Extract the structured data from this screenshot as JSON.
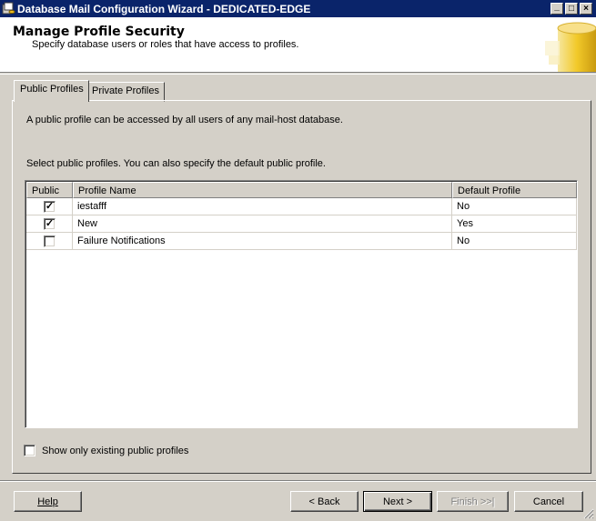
{
  "window": {
    "title": "Database Mail Configuration Wizard - DEDICATED-EDGE",
    "controls": {
      "minimize": "_",
      "maximize": "□",
      "close": "×"
    }
  },
  "header": {
    "title": "Manage Profile Security",
    "subtitle": "Specify database users or roles that have access to profiles."
  },
  "tabs": [
    {
      "label": "Public Profiles",
      "active": true
    },
    {
      "label": "Private Profiles",
      "active": false
    }
  ],
  "panel": {
    "description": "A public profile can be accessed by all users of any mail-host database.",
    "instruction": "Select public profiles. You can also specify the default public profile."
  },
  "grid": {
    "columns": [
      "Public",
      "Profile Name",
      "Default Profile"
    ],
    "rows": [
      {
        "public": true,
        "check": "✓",
        "profile_name": "iestafff",
        "default_profile": "No"
      },
      {
        "public": true,
        "check": "✓",
        "profile_name": "New",
        "default_profile": "Yes"
      },
      {
        "public": false,
        "check": "",
        "profile_name": "Failure Notifications",
        "default_profile": "No"
      }
    ]
  },
  "show_existing": {
    "label": "Show only existing public profiles",
    "checked": false
  },
  "buttons": {
    "help": "Help",
    "back": "< Back",
    "next": "Next >",
    "finish": "Finish >>|",
    "cancel": "Cancel"
  },
  "colors": {
    "titlebar": "#0a246a",
    "face": "#d4d0c8"
  },
  "icons": {
    "title_icon": "database-mail-icon",
    "header_graphic": "database-cylinder-icon"
  }
}
